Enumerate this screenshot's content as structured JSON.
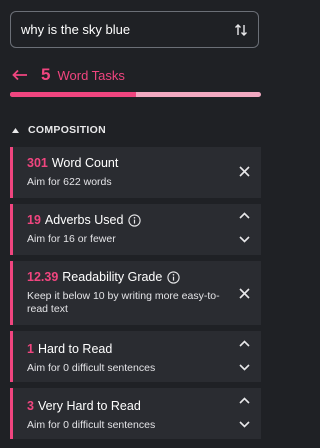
{
  "search": {
    "value": "why is the sky blue"
  },
  "header": {
    "count": "5",
    "label": "Word Tasks"
  },
  "progress": {
    "fraction": 0.5
  },
  "section": {
    "title": "COMPOSITION"
  },
  "cards": [
    {
      "number": "301",
      "title": "Word Count",
      "subtitle": "Aim for 622 words",
      "control": "close-icon"
    },
    {
      "number": "19",
      "title": "Adverbs Used",
      "subtitle": "Aim for 16 or fewer",
      "control": "chevrons",
      "info": true
    },
    {
      "number": "12.39",
      "title": "Readability Grade",
      "subtitle": "Keep it below 10 by writing more easy-to-read text",
      "control": "close-icon",
      "info": true
    },
    {
      "number": "1",
      "title": "Hard to Read",
      "subtitle": "Aim for 0 difficult sentences",
      "control": "chevrons"
    },
    {
      "number": "3",
      "title": "Very Hard to Read",
      "subtitle": "Aim for 0 difficult sentences",
      "control": "chevrons"
    }
  ],
  "colors": {
    "accent": "#f0457f",
    "card": "#2a2c31",
    "background": "#1f2125",
    "progress_track": "#f2a9c1"
  }
}
